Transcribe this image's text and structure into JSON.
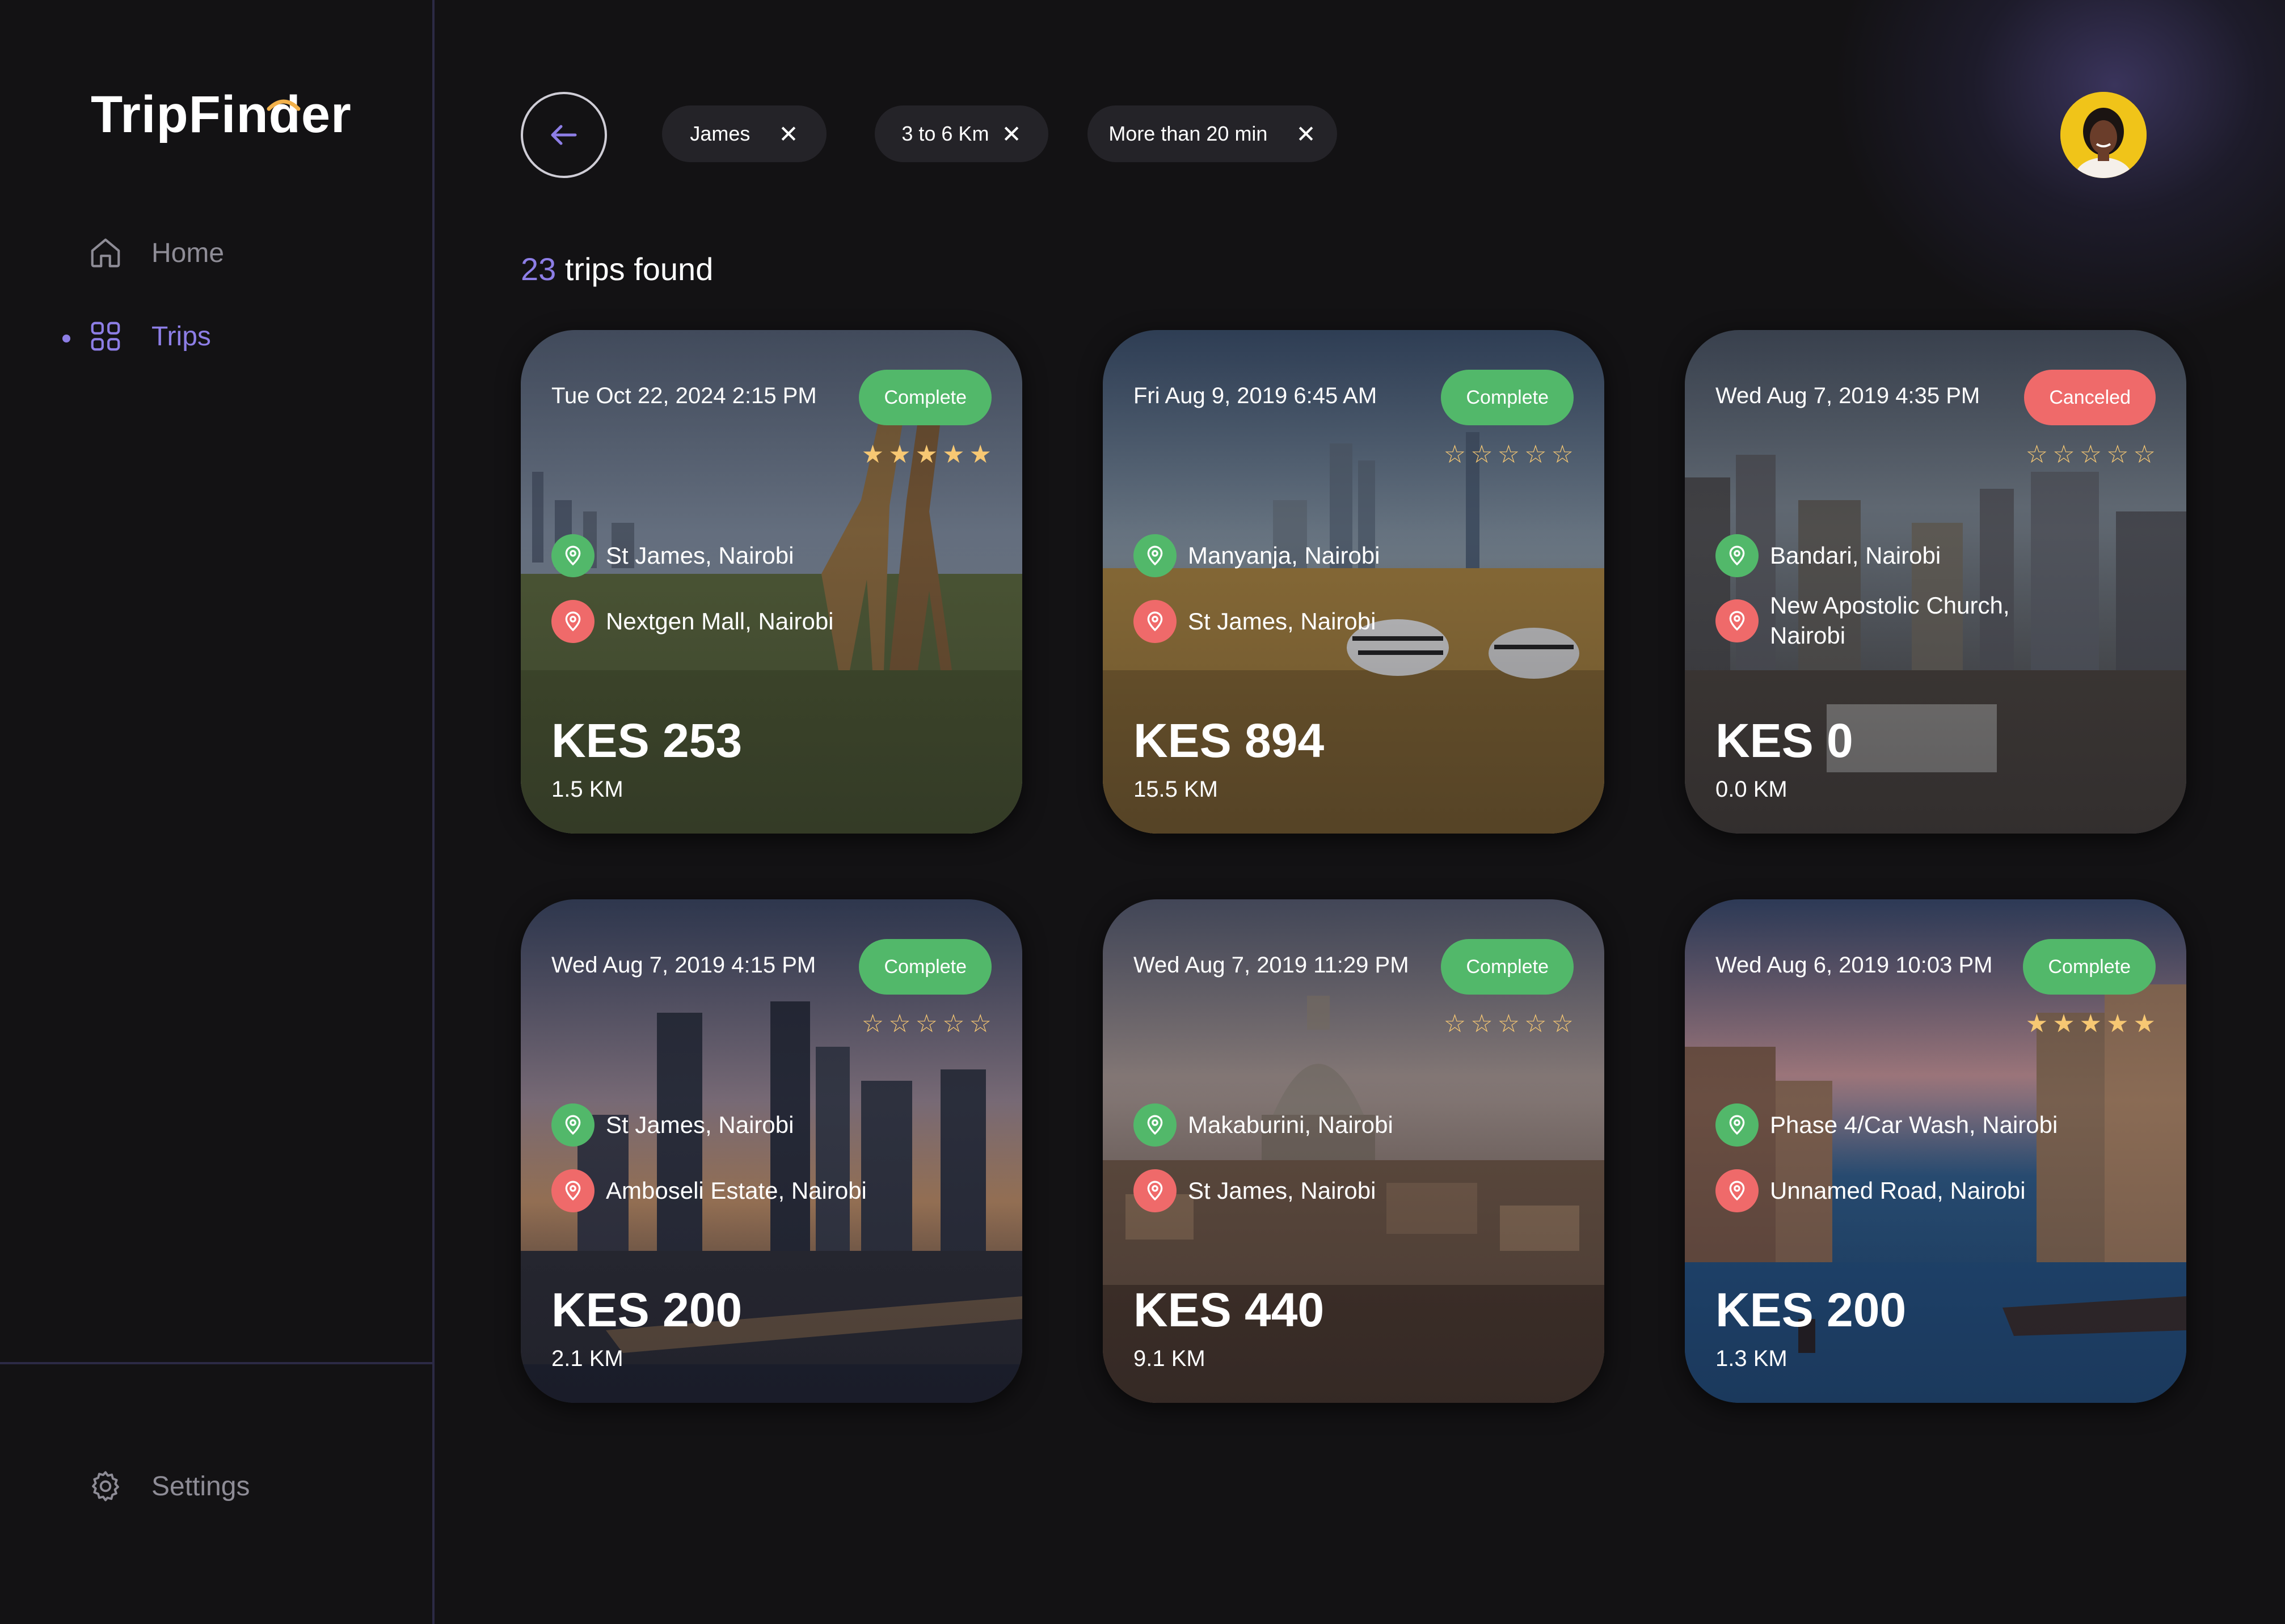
{
  "app": {
    "name": "TripFinder"
  },
  "sidebar": {
    "items": [
      {
        "label": "Home",
        "icon": "home-icon"
      },
      {
        "label": "Trips",
        "icon": "grid-icon",
        "active": true
      }
    ],
    "settings": {
      "label": "Settings",
      "icon": "gear-icon"
    }
  },
  "filters": [
    {
      "label": "James"
    },
    {
      "label": "3 to 6 Km"
    },
    {
      "label": "More than 20 min"
    }
  ],
  "results": {
    "count": "23",
    "suffix": " trips found"
  },
  "colors": {
    "accent": "#8d7ee6",
    "complete": "#52b86a",
    "canceled": "#ef6a6a",
    "star": "#f7c873",
    "background": "#131214"
  },
  "trips": [
    {
      "date": "Tue Oct 22, 2024 2:15 PM",
      "status": "Complete",
      "rating": 5,
      "from": "St James, Nairobi",
      "to": "Nextgen Mall, Nairobi",
      "price": "KES 253",
      "distance": "1.5 KM"
    },
    {
      "date": "Fri Aug 9, 2019 6:45 AM",
      "status": "Complete",
      "rating": 0,
      "from": "Manyanja, Nairobi",
      "to": "St James, Nairobi",
      "price": "KES 894",
      "distance": "15.5 KM"
    },
    {
      "date": "Wed Aug 7, 2019 4:35 PM",
      "status": "Canceled",
      "rating": 0,
      "from": "Bandari, Nairobi",
      "to": "New Apostolic Church, Nairobi",
      "price": "KES 0",
      "distance": "0.0 KM"
    },
    {
      "date": "Wed Aug 7, 2019 4:15 PM",
      "status": "Complete",
      "rating": 0,
      "from": "St James, Nairobi",
      "to": "Amboseli Estate, Nairobi",
      "price": "KES 200",
      "distance": "2.1 KM"
    },
    {
      "date": "Wed Aug 7, 2019 11:29 PM",
      "status": "Complete",
      "rating": 0,
      "from": "Makaburini, Nairobi",
      "to": "St James, Nairobi",
      "price": "KES 440",
      "distance": "9.1 KM"
    },
    {
      "date": "Wed Aug 6, 2019 10:03 PM",
      "status": "Complete",
      "rating": 5,
      "from": "Phase 4/Car Wash, Nairobi",
      "to": "Unnamed Road, Nairobi",
      "price": "KES 200",
      "distance": "1.3 KM"
    }
  ]
}
